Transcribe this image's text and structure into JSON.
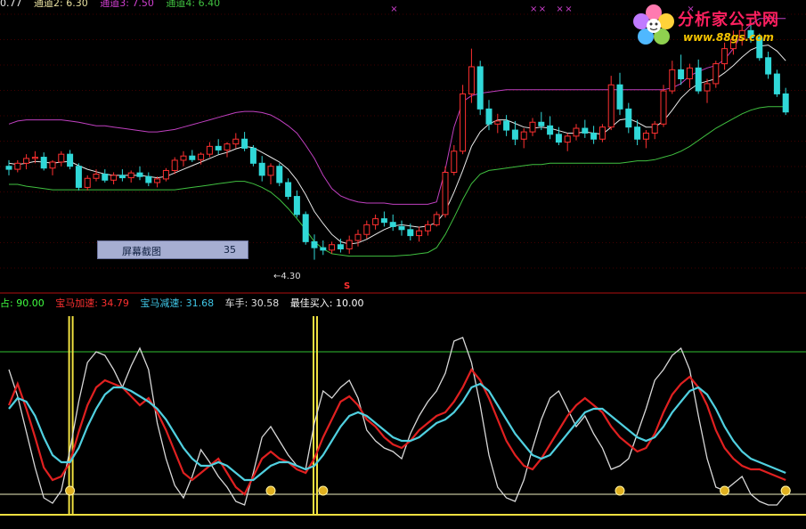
{
  "price_legend": [
    {
      "text": "0.77",
      "color": "#e8e8e8"
    },
    {
      "text": "通道2: 6.30",
      "color": "#e8e0a0"
    },
    {
      "text": "通道3: 7.50",
      "color": "#d040d0"
    },
    {
      "text": "通道4: 6.40",
      "color": "#40c040"
    }
  ],
  "indicator_legend": [
    {
      "text": "占: 90.00",
      "color": "#40ff40"
    },
    {
      "text": "宝马加速: 34.79",
      "color": "#ff3030"
    },
    {
      "text": "宝马减速: 31.68",
      "color": "#40c8e8"
    },
    {
      "text": "车手: 30.58",
      "color": "#e0e0e0"
    },
    {
      "text": "最佳买入: 10.00",
      "color": "#ffffff"
    }
  ],
  "logo": {
    "title": "分析家公式网",
    "url": "www.88gs.com"
  },
  "tooltip": {
    "label": "屏幕截图",
    "value": "35"
  },
  "low_label": "4.30",
  "signal_mark": "S",
  "colors": {
    "bg": "#000000",
    "up": "#ff3030",
    "down": "#30d8d8",
    "ma_white": "#e8e8e8",
    "upper_band": "#c040c0",
    "lower_band": "#40c040",
    "accel": "#e02020",
    "decel": "#50d0e0",
    "driver": "#d8d8d8",
    "spike": "#f0e040",
    "grid": "#400000",
    "separator": "#b01010"
  },
  "chart_data": [
    {
      "type": "candlestick",
      "title": "",
      "ylim": [
        4.0,
        8.4
      ],
      "price_axis_log": false,
      "candles": [
        [
          5.85,
          5.95,
          5.7,
          5.8
        ],
        [
          5.8,
          5.95,
          5.75,
          5.9
        ],
        [
          5.9,
          6.05,
          5.8,
          5.98
        ],
        [
          5.98,
          6.1,
          5.9,
          6.0
        ],
        [
          6.0,
          6.08,
          5.78,
          5.82
        ],
        [
          5.82,
          5.95,
          5.7,
          5.92
        ],
        [
          5.92,
          6.1,
          5.85,
          6.05
        ],
        [
          6.05,
          6.12,
          5.8,
          5.85
        ],
        [
          5.85,
          5.9,
          5.45,
          5.5
        ],
        [
          5.5,
          5.7,
          5.45,
          5.65
        ],
        [
          5.65,
          5.8,
          5.6,
          5.72
        ],
        [
          5.72,
          5.8,
          5.58,
          5.62
        ],
        [
          5.62,
          5.75,
          5.55,
          5.7
        ],
        [
          5.7,
          5.8,
          5.6,
          5.66
        ],
        [
          5.66,
          5.78,
          5.58,
          5.74
        ],
        [
          5.74,
          5.85,
          5.62,
          5.68
        ],
        [
          5.68,
          5.75,
          5.52,
          5.58
        ],
        [
          5.58,
          5.68,
          5.5,
          5.64
        ],
        [
          5.64,
          5.82,
          5.6,
          5.78
        ],
        [
          5.78,
          6.0,
          5.72,
          5.95
        ],
        [
          5.95,
          6.1,
          5.85,
          6.02
        ],
        [
          6.02,
          6.12,
          5.92,
          5.96
        ],
        [
          5.96,
          6.08,
          5.88,
          6.05
        ],
        [
          6.05,
          6.25,
          6.0,
          6.18
        ],
        [
          6.18,
          6.3,
          6.05,
          6.12
        ],
        [
          6.12,
          6.25,
          6.0,
          6.22
        ],
        [
          6.22,
          6.4,
          6.15,
          6.3
        ],
        [
          6.3,
          6.42,
          6.1,
          6.15
        ],
        [
          6.15,
          6.2,
          5.85,
          5.9
        ],
        [
          5.9,
          6.02,
          5.6,
          5.7
        ],
        [
          5.7,
          5.9,
          5.55,
          5.85
        ],
        [
          5.85,
          5.9,
          5.52,
          5.58
        ],
        [
          5.58,
          5.65,
          5.3,
          5.35
        ],
        [
          5.35,
          5.45,
          5.0,
          5.05
        ],
        [
          5.05,
          5.1,
          4.55,
          4.6
        ],
        [
          4.6,
          4.72,
          4.3,
          4.5
        ],
        [
          4.5,
          4.62,
          4.38,
          4.46
        ],
        [
          4.46,
          4.6,
          4.4,
          4.55
        ],
        [
          4.55,
          4.65,
          4.42,
          4.48
        ],
        [
          4.48,
          4.7,
          4.4,
          4.62
        ],
        [
          4.62,
          4.8,
          4.52,
          4.72
        ],
        [
          4.72,
          4.95,
          4.65,
          4.88
        ],
        [
          4.88,
          5.05,
          4.8,
          4.98
        ],
        [
          4.98,
          5.1,
          4.85,
          4.92
        ],
        [
          4.92,
          5.05,
          4.78,
          4.85
        ],
        [
          4.85,
          4.95,
          4.7,
          4.8
        ],
        [
          4.8,
          4.9,
          4.62,
          4.7
        ],
        [
          4.7,
          4.85,
          4.6,
          4.78
        ],
        [
          4.78,
          4.95,
          4.7,
          4.88
        ],
        [
          4.88,
          5.1,
          4.85,
          5.05
        ],
        [
          5.05,
          5.85,
          5.0,
          5.75
        ],
        [
          5.75,
          6.2,
          5.7,
          6.1
        ],
        [
          6.1,
          7.2,
          6.05,
          7.05
        ],
        [
          7.05,
          7.8,
          6.9,
          7.5
        ],
        [
          7.5,
          7.6,
          6.7,
          6.8
        ],
        [
          6.8,
          6.95,
          6.45,
          6.55
        ],
        [
          6.55,
          6.72,
          6.4,
          6.6
        ],
        [
          6.6,
          6.7,
          6.35,
          6.45
        ],
        [
          6.45,
          6.6,
          6.2,
          6.3
        ],
        [
          6.3,
          6.48,
          6.15,
          6.42
        ],
        [
          6.42,
          6.65,
          6.35,
          6.58
        ],
        [
          6.58,
          6.75,
          6.45,
          6.52
        ],
        [
          6.52,
          6.68,
          6.3,
          6.38
        ],
        [
          6.38,
          6.5,
          6.2,
          6.25
        ],
        [
          6.25,
          6.4,
          6.1,
          6.35
        ],
        [
          6.35,
          6.55,
          6.28,
          6.48
        ],
        [
          6.48,
          6.62,
          6.32,
          6.4
        ],
        [
          6.4,
          6.52,
          6.22,
          6.3
        ],
        [
          6.3,
          6.55,
          6.25,
          6.5
        ],
        [
          6.5,
          7.35,
          6.45,
          7.2
        ],
        [
          7.2,
          7.4,
          6.7,
          6.8
        ],
        [
          6.8,
          6.9,
          6.4,
          6.5
        ],
        [
          6.5,
          6.62,
          6.2,
          6.3
        ],
        [
          6.3,
          6.45,
          6.15,
          6.4
        ],
        [
          6.4,
          6.6,
          6.3,
          6.55
        ],
        [
          6.55,
          7.2,
          6.5,
          7.1
        ],
        [
          7.1,
          7.6,
          7.05,
          7.45
        ],
        [
          7.45,
          7.7,
          7.2,
          7.3
        ],
        [
          7.3,
          7.55,
          7.15,
          7.48
        ],
        [
          7.48,
          7.62,
          7.05,
          7.1
        ],
        [
          7.1,
          7.3,
          6.9,
          7.22
        ],
        [
          7.22,
          7.6,
          7.15,
          7.55
        ],
        [
          7.55,
          7.9,
          7.45,
          7.8
        ],
        [
          7.8,
          8.1,
          7.7,
          7.95
        ],
        [
          7.95,
          8.2,
          7.85,
          8.1
        ],
        [
          8.1,
          8.25,
          7.9,
          7.98
        ],
        [
          7.98,
          8.05,
          7.6,
          7.65
        ],
        [
          7.65,
          7.75,
          7.3,
          7.38
        ],
        [
          7.38,
          7.45,
          7.0,
          7.05
        ],
        [
          7.05,
          7.15,
          6.7,
          6.75
        ]
      ],
      "ma": [
        5.9,
        5.88,
        5.9,
        5.93,
        5.92,
        5.9,
        5.92,
        5.93,
        5.86,
        5.8,
        5.76,
        5.72,
        5.7,
        5.7,
        5.7,
        5.7,
        5.68,
        5.66,
        5.68,
        5.74,
        5.8,
        5.86,
        5.92,
        5.98,
        6.04,
        6.08,
        6.14,
        6.18,
        6.16,
        6.08,
        6.0,
        5.92,
        5.8,
        5.62,
        5.38,
        5.1,
        4.9,
        4.72,
        4.6,
        4.56,
        4.58,
        4.64,
        4.72,
        4.8,
        4.86,
        4.88,
        4.86,
        4.84,
        4.86,
        4.92,
        5.1,
        5.42,
        5.78,
        6.18,
        6.42,
        6.55,
        6.62,
        6.62,
        6.56,
        6.5,
        6.48,
        6.5,
        6.48,
        6.44,
        6.4,
        6.4,
        6.42,
        6.4,
        6.38,
        6.5,
        6.62,
        6.64,
        6.58,
        6.5,
        6.5,
        6.6,
        6.78,
        6.98,
        7.12,
        7.22,
        7.26,
        7.3,
        7.4,
        7.52,
        7.66,
        7.78,
        7.84,
        7.86,
        7.76,
        7.6
      ],
      "upper_band": [
        6.55,
        6.6,
        6.62,
        6.62,
        6.62,
        6.62,
        6.62,
        6.6,
        6.58,
        6.55,
        6.52,
        6.52,
        6.5,
        6.48,
        6.46,
        6.44,
        6.42,
        6.42,
        6.44,
        6.46,
        6.5,
        6.54,
        6.58,
        6.62,
        6.66,
        6.7,
        6.74,
        6.76,
        6.76,
        6.74,
        6.7,
        6.62,
        6.52,
        6.4,
        6.2,
        5.98,
        5.7,
        5.48,
        5.36,
        5.3,
        5.26,
        5.24,
        5.24,
        5.24,
        5.22,
        5.22,
        5.22,
        5.22,
        5.22,
        5.26,
        5.8,
        6.5,
        6.92,
        7.02,
        7.06,
        7.08,
        7.1,
        7.12,
        7.12,
        7.12,
        7.12,
        7.12,
        7.12,
        7.12,
        7.12,
        7.12,
        7.12,
        7.12,
        7.12,
        7.12,
        7.12,
        7.12,
        7.12,
        7.12,
        7.12,
        7.12,
        7.15,
        7.22,
        7.35,
        7.42,
        7.48,
        7.52,
        7.62,
        7.8,
        8.05,
        8.2,
        8.3,
        8.3,
        8.3,
        8.3
      ],
      "lower_band": [
        5.55,
        5.55,
        5.52,
        5.5,
        5.48,
        5.46,
        5.46,
        5.46,
        5.46,
        5.46,
        5.46,
        5.46,
        5.46,
        5.46,
        5.46,
        5.46,
        5.46,
        5.46,
        5.46,
        5.46,
        5.48,
        5.5,
        5.52,
        5.54,
        5.56,
        5.58,
        5.6,
        5.6,
        5.56,
        5.5,
        5.42,
        5.3,
        5.15,
        4.98,
        4.8,
        4.6,
        4.48,
        4.4,
        4.38,
        4.36,
        4.36,
        4.36,
        4.36,
        4.36,
        4.36,
        4.37,
        4.38,
        4.4,
        4.42,
        4.5,
        4.72,
        5.0,
        5.3,
        5.56,
        5.72,
        5.78,
        5.8,
        5.82,
        5.84,
        5.86,
        5.88,
        5.88,
        5.9,
        5.9,
        5.9,
        5.9,
        5.9,
        5.9,
        5.9,
        5.9,
        5.9,
        5.92,
        5.94,
        5.94,
        5.96,
        6.0,
        6.04,
        6.1,
        6.18,
        6.28,
        6.38,
        6.48,
        6.56,
        6.64,
        6.72,
        6.78,
        6.82,
        6.84,
        6.84,
        6.84
      ]
    },
    {
      "type": "line",
      "title": "",
      "ylim": [
        -5,
        115
      ],
      "reference_lines": [
        {
          "name": "占",
          "value": 90
        },
        {
          "name": "最佳买入",
          "value": 10
        }
      ],
      "series": [
        {
          "name": "宝马加速",
          "values": [
            60,
            72,
            58,
            42,
            25,
            18,
            20,
            28,
            45,
            60,
            70,
            74,
            72,
            70,
            65,
            60,
            64,
            56,
            46,
            34,
            22,
            18,
            22,
            26,
            30,
            22,
            14,
            10,
            20,
            30,
            34,
            30,
            28,
            24,
            22,
            30,
            42,
            52,
            62,
            65,
            60,
            52,
            48,
            42,
            38,
            36,
            40,
            46,
            50,
            54,
            56,
            62,
            70,
            80,
            74,
            64,
            52,
            40,
            32,
            26,
            24,
            30,
            38,
            46,
            54,
            60,
            64,
            60,
            56,
            48,
            42,
            38,
            34,
            36,
            44,
            56,
            66,
            72,
            76,
            70,
            60,
            46,
            36,
            30,
            26,
            24,
            24,
            22,
            20,
            18
          ]
        },
        {
          "name": "宝马减速",
          "values": [
            58,
            64,
            62,
            54,
            42,
            32,
            28,
            28,
            36,
            48,
            58,
            66,
            70,
            70,
            68,
            65,
            62,
            58,
            52,
            44,
            36,
            30,
            26,
            26,
            28,
            26,
            22,
            18,
            18,
            22,
            26,
            28,
            28,
            26,
            24,
            26,
            32,
            40,
            48,
            54,
            56,
            54,
            50,
            46,
            42,
            40,
            40,
            42,
            46,
            50,
            52,
            56,
            62,
            70,
            72,
            68,
            60,
            52,
            44,
            38,
            32,
            30,
            32,
            38,
            44,
            50,
            56,
            58,
            58,
            54,
            50,
            46,
            42,
            40,
            42,
            48,
            56,
            62,
            68,
            70,
            66,
            58,
            48,
            40,
            34,
            30,
            28,
            26,
            24,
            22
          ]
        },
        {
          "name": "车手",
          "values": [
            80,
            65,
            45,
            25,
            8,
            5,
            12,
            35,
            62,
            84,
            90,
            88,
            80,
            70,
            82,
            92,
            80,
            50,
            30,
            15,
            8,
            20,
            35,
            28,
            20,
            14,
            6,
            4,
            22,
            42,
            48,
            40,
            32,
            26,
            24,
            50,
            68,
            64,
            70,
            74,
            64,
            46,
            40,
            36,
            34,
            30,
            44,
            54,
            62,
            68,
            78,
            96,
            98,
            84,
            60,
            32,
            14,
            8,
            6,
            18,
            36,
            52,
            64,
            68,
            58,
            48,
            54,
            44,
            36,
            24,
            26,
            30,
            44,
            58,
            74,
            80,
            88,
            92,
            80,
            54,
            30,
            14,
            12,
            16,
            20,
            10,
            6,
            4,
            4,
            10
          ]
        },
        {
          "name": "spike",
          "values": [
            0,
            0,
            0,
            0,
            0,
            0,
            0,
            110,
            0,
            0,
            0,
            0,
            0,
            0,
            0,
            0,
            0,
            0,
            0,
            0,
            0,
            0,
            0,
            0,
            0,
            0,
            0,
            0,
            0,
            0,
            0,
            0,
            0,
            0,
            0,
            110,
            0,
            0,
            0,
            0,
            0,
            0,
            0,
            0,
            0,
            0,
            0,
            0,
            0,
            0,
            0,
            0,
            0,
            0,
            0,
            0,
            0,
            0,
            0,
            0,
            0,
            0,
            0,
            0,
            0,
            0,
            0,
            0,
            0,
            0,
            0,
            0,
            0,
            0,
            0,
            0,
            0,
            0,
            0,
            0,
            0,
            0,
            0,
            0,
            0,
            0,
            0,
            0,
            0,
            0
          ]
        }
      ],
      "buy_markers": [
        7,
        30,
        36,
        70,
        82,
        105,
        108
      ]
    }
  ],
  "sell_markers": [
    44,
    60,
    61,
    63,
    64,
    74,
    78,
    97,
    98
  ]
}
